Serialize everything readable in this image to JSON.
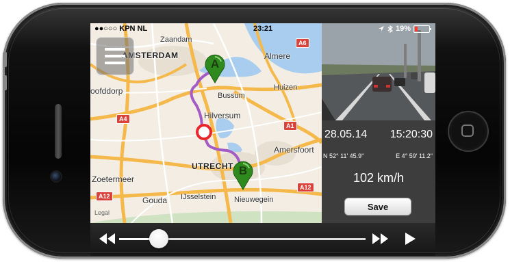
{
  "status_bar": {
    "carrier": "●●○○○ KPN NL",
    "time": "23:21",
    "battery_text": "19%",
    "battery_level": 0.19,
    "battery_color": "#ff3b30"
  },
  "map": {
    "places": {
      "zaandam": "Zaandam",
      "amsterdam": "AMSTERDAM",
      "almere": "Almere",
      "hoofddorp": "oofddorp",
      "bussum": "Bussum",
      "huizen": "Huizen",
      "hilversum": "Hilversum",
      "amersfoort": "Amersfoort",
      "utrecht": "UTRECHT",
      "zoetermeer": "Zoetermeer",
      "gouda": "Gouda",
      "ijsselstein": "IJsselstein",
      "nieuwegein": "Nieuwegein"
    },
    "road_shields": {
      "a6": "A6",
      "a4": "A4",
      "a1": "A1",
      "a12_left": "A12",
      "a12_right": "A12"
    },
    "legal_text": "Legal",
    "marker_a": "A",
    "marker_b": "B",
    "route_color": "#a45bc4",
    "marker_color": "#2f8a1e"
  },
  "info": {
    "date": "28.05.14",
    "time": "15:20:30",
    "latitude": "N 52° 11' 45.9\"",
    "longitude": "E 4° 59' 11.2\"",
    "speed": "102 km/h",
    "save_label": "Save"
  },
  "playback": {
    "progress": 0.16
  }
}
